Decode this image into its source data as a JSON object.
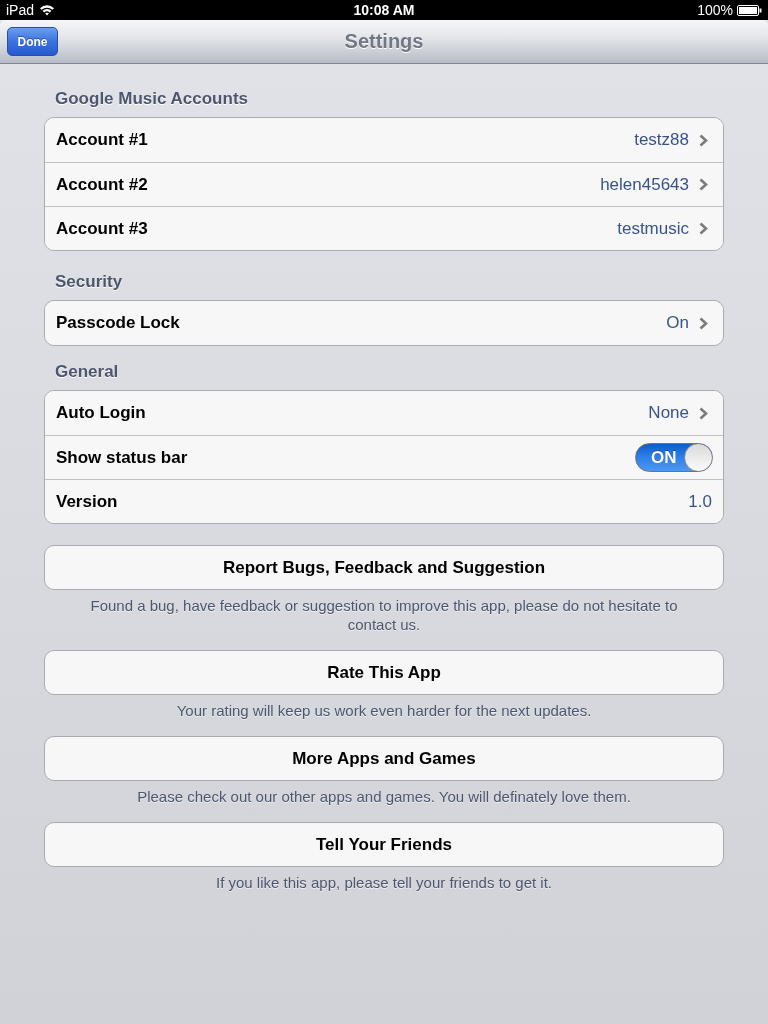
{
  "status_bar": {
    "device": "iPad",
    "time": "10:08 AM",
    "battery": "100%"
  },
  "nav_bar": {
    "title": "Settings",
    "left_button": "Done"
  },
  "sections": [
    {
      "header": "Google Music Accounts",
      "rows": [
        {
          "kind": "disclosure",
          "label": "Account #1",
          "value": "testz88"
        },
        {
          "kind": "disclosure",
          "label": "Account #2",
          "value": "helen45643"
        },
        {
          "kind": "disclosure",
          "label": "Account #3",
          "value": "testmusic"
        }
      ]
    },
    {
      "header": "Security",
      "rows": [
        {
          "kind": "disclosure",
          "label": "Passcode Lock",
          "value": "On"
        }
      ]
    },
    {
      "header": "General",
      "rows": [
        {
          "kind": "disclosure",
          "label": "Auto Login",
          "value": "None"
        },
        {
          "kind": "switch",
          "label": "Show status bar",
          "on": true,
          "switch_text": "ON"
        },
        {
          "kind": "value",
          "label": "Version",
          "value": "1.0"
        }
      ]
    }
  ],
  "actions": [
    {
      "label": "Report Bugs, Feedback and Suggestion",
      "footer": "Found a bug, have feedback or suggestion to improve this app, please do not hesitate to contact us."
    },
    {
      "label": "Rate This App",
      "footer": "Your rating will keep us work even harder for the next updates."
    },
    {
      "label": "More Apps and Games",
      "footer": "Please check out our other apps and games. You will definately love them."
    },
    {
      "label": "Tell Your Friends",
      "footer": "If you like this app, please tell your friends to get it."
    }
  ]
}
